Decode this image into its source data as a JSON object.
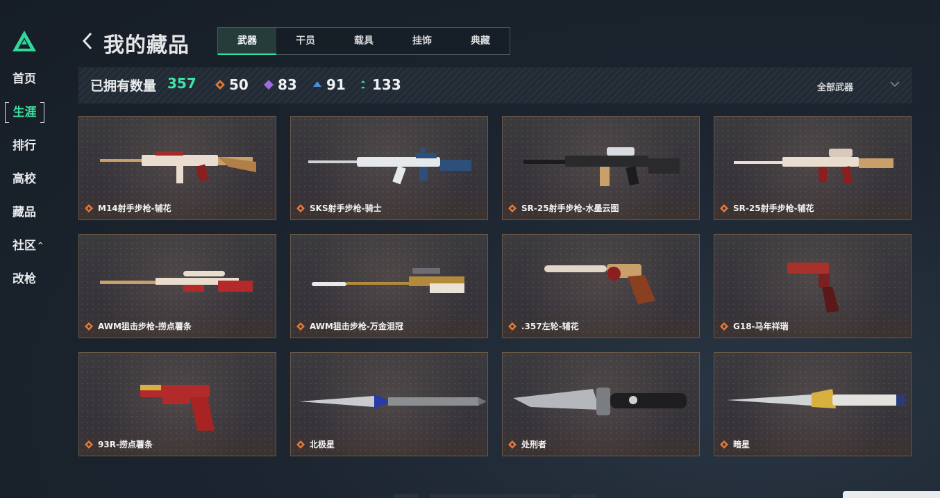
{
  "sidebar": {
    "items": [
      {
        "label": "首页",
        "active": false
      },
      {
        "label": "生涯",
        "active": true
      },
      {
        "label": "排行",
        "active": false
      },
      {
        "label": "高校",
        "active": false
      },
      {
        "label": "藏品",
        "active": false
      },
      {
        "label": "社区",
        "active": false,
        "has_caret": true
      },
      {
        "label": "改枪",
        "active": false
      }
    ],
    "accent_color": "#39e0a0"
  },
  "header": {
    "title": "我的藏品",
    "tabs": [
      {
        "label": "武器",
        "active": true
      },
      {
        "label": "干员",
        "active": false
      },
      {
        "label": "载具",
        "active": false
      },
      {
        "label": "挂饰",
        "active": false
      },
      {
        "label": "典藏",
        "active": false
      }
    ]
  },
  "stats": {
    "owned_label": "已拥有数量",
    "owned_count": "357",
    "rarity_counts": [
      {
        "icon": "orange-diamond-icon",
        "color": "#e07a3c",
        "value": "50"
      },
      {
        "icon": "purple-diamond-icon",
        "color": "#9a6ee0",
        "value": "83"
      },
      {
        "icon": "blue-diamond-icon",
        "color": "#4a8ee0",
        "value": "91"
      },
      {
        "icon": "green-diamond-icon",
        "color": "#3ee6a4",
        "value": "133"
      }
    ],
    "filter_label": "全部武器"
  },
  "items": [
    {
      "name": "M14射手步枪-辅花",
      "weapon": "rifle"
    },
    {
      "name": "SKS射手步枪-骑士",
      "weapon": "rifle"
    },
    {
      "name": "SR-25射手步枪-水墨云图",
      "weapon": "rifle"
    },
    {
      "name": "SR-25射手步枪-辅花",
      "weapon": "rifle"
    },
    {
      "name": "AWM狙击步枪-捞点薯条",
      "weapon": "sniper"
    },
    {
      "name": "AWM狙击步枪-万金泪冠",
      "weapon": "sniper"
    },
    {
      "name": ".357左轮-辅花",
      "weapon": "revolver"
    },
    {
      "name": "G18-马年祥瑞",
      "weapon": "pistol"
    },
    {
      "name": "93R-捞点薯条",
      "weapon": "pistol"
    },
    {
      "name": "北极星",
      "weapon": "dagger"
    },
    {
      "name": "处刑者",
      "weapon": "knife"
    },
    {
      "name": "暗星",
      "weapon": "blade"
    }
  ],
  "rarity_color": "#e07a3c"
}
